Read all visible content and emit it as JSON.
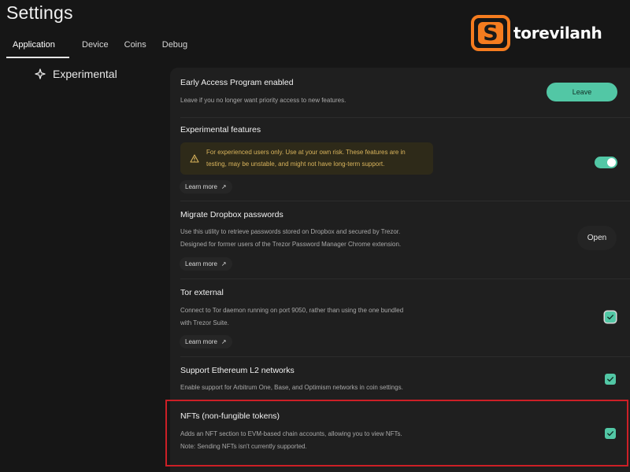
{
  "page": {
    "title": "Settings"
  },
  "tabs": [
    {
      "label": "Application",
      "active": true
    },
    {
      "label": "Device",
      "active": false
    },
    {
      "label": "Coins",
      "active": false
    },
    {
      "label": "Debug",
      "active": false
    }
  ],
  "sidebar": {
    "item": {
      "label": "Experimental",
      "icon": "experimental-star-icon"
    }
  },
  "watermark": {
    "logo_text": "torevilanh",
    "logo_letter": "S",
    "colors": {
      "orange": "#f57c1f",
      "text": "#ffffff"
    }
  },
  "settings": {
    "early_access": {
      "title": "Early Access Program enabled",
      "description": "Leave if you no longer want priority access to new features.",
      "button": "Leave"
    },
    "experimental": {
      "title": "Experimental features",
      "warning_line1": "For experienced users only. Use at your own risk. These features are in",
      "warning_line2": "testing, may be unstable, and might not have long-term support.",
      "learn_more": "Learn more",
      "enabled": true
    },
    "dropbox": {
      "title": "Migrate Dropbox passwords",
      "description_line1": "Use this utility to retrieve passwords stored on Dropbox and secured by Trezor.",
      "description_line2": "Designed for former users of the Trezor Password Manager Chrome extension.",
      "learn_more": "Learn more",
      "button": "Open"
    },
    "tor": {
      "title": "Tor external",
      "description_line1": "Connect to Tor daemon running on port 9050, rather than using the one bundled",
      "description_line2": "with Trezor Suite.",
      "learn_more": "Learn more",
      "checked": true
    },
    "l2": {
      "title": "Support Ethereum L2 networks",
      "description": "Enable support for Arbitrum One, Base, and Optimism networks in coin settings.",
      "checked": true
    },
    "nfts": {
      "title": "NFTs (non-fungible tokens)",
      "description_line1": "Adds an NFT section to EVM-based chain accounts, allowing you to view NFTs.",
      "description_line2": "Note: Sending NFTs isn't currently supported.",
      "checked": true
    }
  },
  "colors": {
    "background": "#161616",
    "panel": "#1f1f1f",
    "accent": "#52c7a5",
    "warning_bg": "#2e2a19",
    "warning_text": "#d9b45c",
    "highlight": "#cc1f26"
  }
}
